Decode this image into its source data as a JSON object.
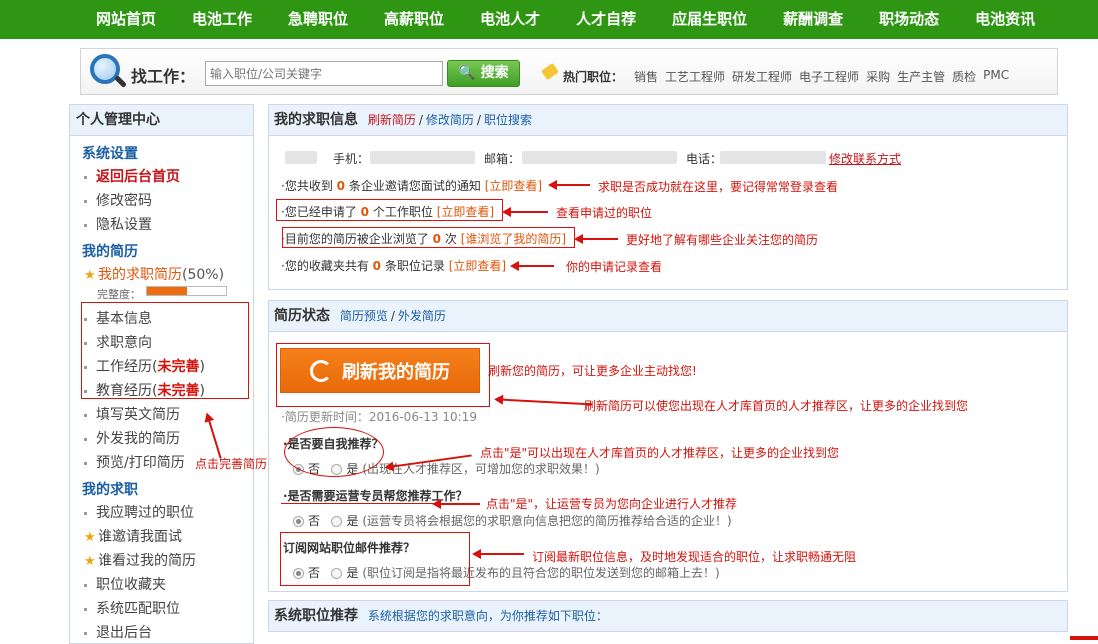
{
  "nav": [
    "网站首页",
    "电池工作",
    "急聘职位",
    "高薪职位",
    "电池人才",
    "人才自荐",
    "应届生职位",
    "薪酬调查",
    "职场动态",
    "电池资讯"
  ],
  "search": {
    "label": "找工作：",
    "placeholder": "输入职位/公司关键字",
    "button": "搜索",
    "hot_label": "热门职位：",
    "hot": [
      "销售",
      "工艺工程师",
      "研发工程师",
      "电子工程师",
      "采购",
      "生产主管",
      "质检",
      "PMC"
    ]
  },
  "sidebar": {
    "title": "个人管理中心",
    "sec1": "系统设置",
    "home": "返回后台首页",
    "pwd": "修改密码",
    "privacy": "隐私设置",
    "sec2": "我的简历",
    "resume": "我的求职简历",
    "resume_pct": "(50%)",
    "progress_label": "完整度：",
    "progress_value": 0.5,
    "basic": "基本信息",
    "intent": "求职意向",
    "work": "工作经历",
    "edu": "教育经历",
    "incomplete": "未完善",
    "english": "填写英文简历",
    "send": "外发我的简历",
    "preview": "预览/打印简历",
    "sec3": "我的求职",
    "applied": "我应聘过的职位",
    "invited": "谁邀请我面试",
    "viewed": "谁看过我的简历",
    "fav": "职位收藏夹",
    "match": "系统匹配职位",
    "logout": "退出后台"
  },
  "info": {
    "title": "我的求职信息",
    "refresh": "刷新简历",
    "edit": "修改简历",
    "search": "职位搜索",
    "phone_label": "手机：",
    "email_label": "邮箱：",
    "tel_label": "电话：",
    "modify_contact": "修改联系方式",
    "l1a": "·您共收到",
    "l1n": "0",
    "l1b": "条企业邀请您面试的通知",
    "l1link": "[立即查看]",
    "l2a": "·您已经申请了",
    "l2n": "0",
    "l2b": "个工作职位",
    "l2link": "[立即查看]",
    "l3a": "·目前您的简历被企业浏览了",
    "l3n": "0",
    "l3b": "次",
    "l3link": "[谁浏览了我的简历]",
    "l4a": "·您的收藏夹共有",
    "l4n": "0",
    "l4b": "条职位记录",
    "l4link": "[立即查看]"
  },
  "status": {
    "title": "简历状态",
    "preview": "简历预览",
    "send": "外发简历",
    "refresh_btn": "刷新我的简历",
    "updated": "·简历更新时间：2016-06-13 10:19",
    "q1": "·是否要自我推荐？",
    "q1_no": "否",
    "q1_yes": "是",
    "q1_hint": "(出现在人才推荐区，可增加您的求职效果！)",
    "q2": "·是否需要运营专员帮您推荐工作？",
    "q2_no": "否",
    "q2_yes": "是",
    "q2_hint": "(运营专员将会根据您的求职意向信息把您的简历推荐给合适的企业！)",
    "q3": "订阅网站职位邮件推荐？",
    "q3_no": "否",
    "q3_yes": "是",
    "q3_hint": "(职位订阅是指将最近发布的且符合您的职位发送到您的邮箱上去！)"
  },
  "recommend": {
    "title": "系统职位推荐",
    "desc": "系统根据您的求职意向，为你推荐如下职位："
  },
  "annotations": {
    "a1": "求职是否成功就在这里，要记得常常登录查看",
    "a2": "查看申请过的职位",
    "a3": "更好地了解有哪些企业关注您的简历",
    "a4": "你的申请记录查看",
    "a5": "刷新您的简历，可让更多企业主动找您!",
    "a6": "刷新简历可以使您出现在人才库首页的人才推荐区，让更多的企业找到您",
    "a7": "点击完善简历",
    "a8": "点击\"是\"可以出现在人才库首页的人才推荐区，让更多的企业找到您",
    "a9": "点击\"是\"，让运营专员为您向企业进行人才推荐",
    "a10": "订阅最新职位信息，及时地发现适合的职位，让求职畅通无阻"
  },
  "colors": {
    "nav": "#2f9614",
    "accent": "#e0560c",
    "annotation": "#d4130c",
    "link": "#1b5fa5"
  }
}
